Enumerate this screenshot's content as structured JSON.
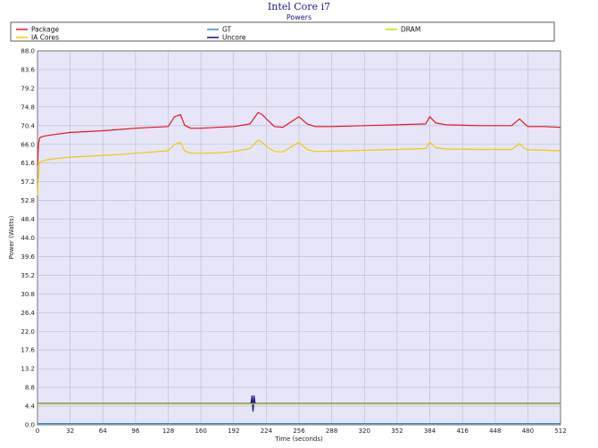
{
  "chart_data": {
    "type": "line",
    "title": "Intel Core i7",
    "subtitle": "Powers",
    "xlabel": "Time (seconds)",
    "ylabel": "Power (Watts)",
    "xlim": [
      0,
      512
    ],
    "ylim": [
      0,
      88
    ],
    "xticks": [
      0,
      32,
      64,
      96,
      128,
      160,
      192,
      224,
      256,
      288,
      320,
      352,
      384,
      416,
      448,
      480,
      512
    ],
    "yticks": [
      "0.0",
      "4.4",
      "8.8",
      "13.2",
      "17.6",
      "22.0",
      "26.4",
      "30.8",
      "35.2",
      "39.6",
      "44.0",
      "48.4",
      "52.8",
      "57.2",
      "61.6",
      "66.0",
      "70.4",
      "74.8",
      "79.2",
      "83.6",
      "88.0"
    ],
    "grid": true,
    "legend_position": "top",
    "plot_background": "#e6e6f8",
    "series": [
      {
        "name": "Package",
        "color": "#e8141c",
        "x": [
          0,
          1,
          2,
          4,
          8,
          16,
          32,
          48,
          64,
          80,
          96,
          112,
          128,
          134,
          140,
          144,
          150,
          160,
          176,
          192,
          208,
          216,
          220,
          224,
          232,
          240,
          256,
          264,
          272,
          288,
          320,
          352,
          380,
          384,
          390,
          400,
          432,
          464,
          472,
          476,
          480,
          496,
          512
        ],
        "y": [
          61.0,
          66.0,
          67.5,
          67.8,
          68.0,
          68.3,
          68.8,
          69.0,
          69.2,
          69.5,
          69.8,
          70.0,
          70.2,
          72.5,
          73.0,
          70.5,
          69.8,
          69.8,
          70.0,
          70.2,
          70.8,
          73.5,
          73.0,
          72.0,
          70.2,
          70.0,
          72.5,
          70.8,
          70.2,
          70.2,
          70.4,
          70.6,
          70.8,
          72.5,
          71.0,
          70.6,
          70.4,
          70.4,
          72.0,
          71.0,
          70.2,
          70.2,
          70.0
        ]
      },
      {
        "name": "IA Cores",
        "color": "#f5c800",
        "x": [
          0,
          1,
          2,
          4,
          8,
          16,
          32,
          48,
          64,
          80,
          96,
          112,
          128,
          134,
          140,
          144,
          150,
          160,
          176,
          192,
          208,
          216,
          220,
          224,
          232,
          240,
          256,
          264,
          272,
          288,
          320,
          352,
          380,
          384,
          390,
          400,
          432,
          464,
          472,
          476,
          480,
          496,
          512
        ],
        "y": [
          54.0,
          59.0,
          61.8,
          62.0,
          62.3,
          62.6,
          63.0,
          63.2,
          63.4,
          63.6,
          63.9,
          64.2,
          64.5,
          66.0,
          66.5,
          64.5,
          63.9,
          63.9,
          64.0,
          64.3,
          65.0,
          67.0,
          66.5,
          65.5,
          64.3,
          64.2,
          66.5,
          64.8,
          64.3,
          64.4,
          64.6,
          64.8,
          65.0,
          66.5,
          65.2,
          64.9,
          64.8,
          64.8,
          66.2,
          65.2,
          64.7,
          64.6,
          64.5
        ]
      },
      {
        "name": "GT",
        "color": "#2a8fd8",
        "x": [
          0,
          512
        ],
        "y": [
          0.3,
          0.3
        ]
      },
      {
        "name": "Uncore",
        "color": "#0a0a8a",
        "x": [
          0,
          200,
          209,
          210,
          211,
          212,
          213,
          222,
          512
        ],
        "y": [
          5.0,
          5.0,
          5.0,
          6.8,
          3.2,
          6.8,
          5.0,
          5.0,
          5.0
        ]
      },
      {
        "name": "DRAM",
        "color": "#c8e000",
        "x": [
          0,
          512
        ],
        "y": [
          4.9,
          4.9
        ]
      }
    ],
    "legend": [
      {
        "name": "Package",
        "color": "#e8141c"
      },
      {
        "name": "GT",
        "color": "#2a8fd8"
      },
      {
        "name": "DRAM",
        "color": "#c8e000"
      },
      {
        "name": "IA Cores",
        "color": "#f5c800"
      },
      {
        "name": "Uncore",
        "color": "#0a0a8a"
      }
    ]
  }
}
